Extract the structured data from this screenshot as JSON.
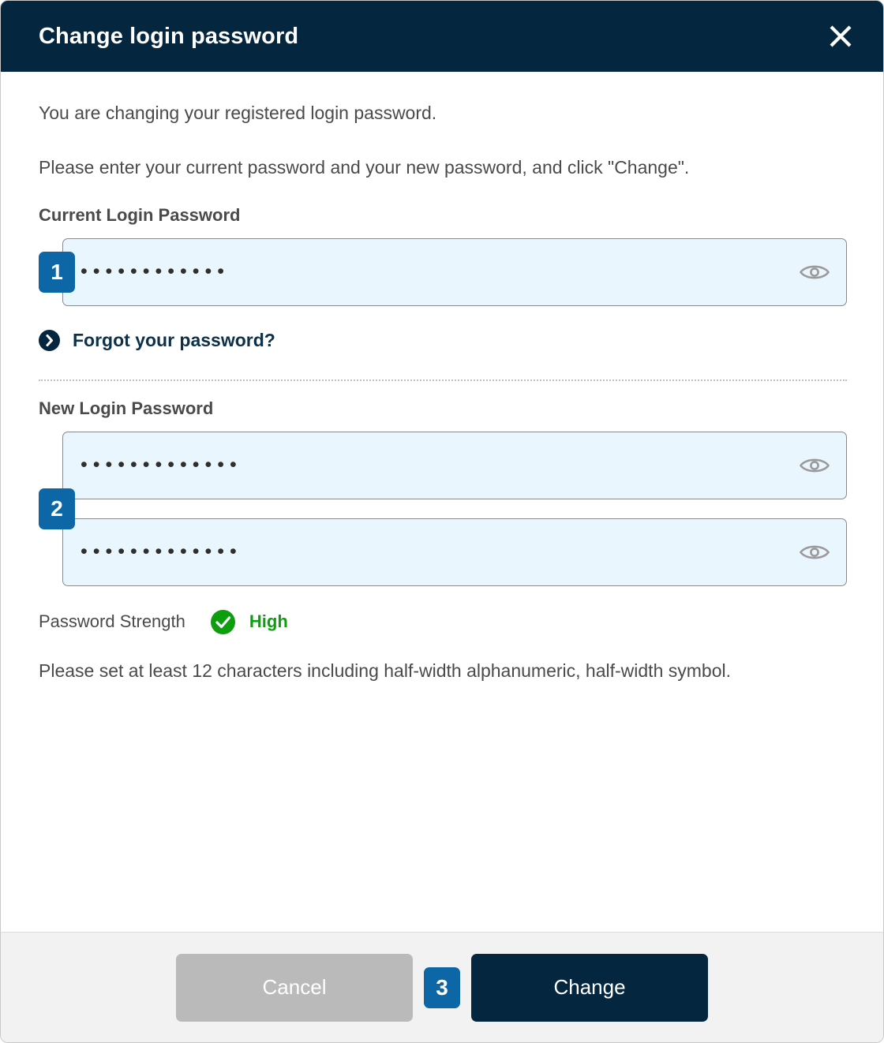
{
  "dialog": {
    "title": "Change login password",
    "close_icon": "close-icon"
  },
  "body": {
    "intro_line1": "You are changing your registered login password.",
    "intro_line2": "Please enter your current password and your new password, and click \"Change\".",
    "current_password": {
      "label": "Current Login Password",
      "value": "••••••••••••",
      "step_badge": "1",
      "toggle_icon": "eye-icon"
    },
    "forgot_link": {
      "label": "Forgot your password?",
      "icon": "chevron-right-circle-icon"
    },
    "new_password": {
      "label": "New Login Password",
      "step_badge": "2",
      "value_1": "•••••••••••••",
      "value_2": "•••••••••••••",
      "toggle_icon": "eye-icon"
    },
    "strength": {
      "label": "Password Strength",
      "value": "High",
      "icon": "check-circle-icon",
      "color": "#0d9e0d"
    },
    "hint": "Please set at least 12 characters including half-width alphanumeric, half-width symbol."
  },
  "footer": {
    "cancel_label": "Cancel",
    "change_label": "Change",
    "step_badge": "3"
  },
  "colors": {
    "header_bg": "#04263f",
    "badge_blue": "#0d66a6",
    "input_bg": "#eaf6fd",
    "input_border": "#8a8a8a",
    "footer_bg": "#f2f2f2",
    "cancel_bg": "#bababa",
    "primary_bg": "#04263f",
    "success_green": "#0d9e0d"
  }
}
